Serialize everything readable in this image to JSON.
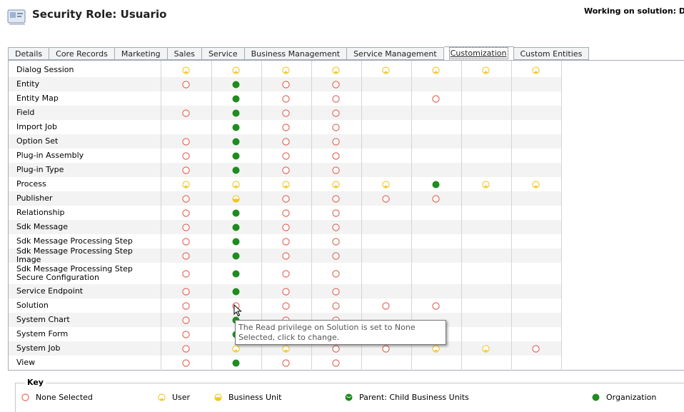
{
  "header": {
    "title": "Security Role: Usuario",
    "solution_text": "Working on solution: Defa"
  },
  "tabs": [
    {
      "label": "Details"
    },
    {
      "label": "Core Records"
    },
    {
      "label": "Marketing"
    },
    {
      "label": "Sales"
    },
    {
      "label": "Service"
    },
    {
      "label": "Business Management"
    },
    {
      "label": "Service Management"
    },
    {
      "label": "Customization",
      "active": true
    },
    {
      "label": "Custom Entities"
    }
  ],
  "privilege_levels": {
    "N": "None Selected",
    "U": "User",
    "B": "Business Unit",
    "P": "Parent: Child Business Units",
    "O": "Organization"
  },
  "colors": {
    "none": "#e25f4f",
    "user": "#f3c61f",
    "organization": "#1e8c1e",
    "tab_border": "#a5acb5"
  },
  "rows": [
    {
      "label": "Dialog Session",
      "cells": [
        "U",
        "U",
        "U",
        "U",
        "U",
        "U",
        "U",
        "U"
      ]
    },
    {
      "label": "Entity",
      "cells": [
        "N",
        "O",
        "N",
        "N",
        "",
        "",
        "",
        ""
      ]
    },
    {
      "label": "Entity Map",
      "cells": [
        "",
        "O",
        "N",
        "N",
        "",
        "N",
        "",
        ""
      ]
    },
    {
      "label": "Field",
      "cells": [
        "N",
        "O",
        "N",
        "N",
        "",
        "",
        "",
        ""
      ]
    },
    {
      "label": "Import Job",
      "cells": [
        "",
        "O",
        "N",
        "N",
        "",
        "",
        "",
        ""
      ]
    },
    {
      "label": "Option Set",
      "cells": [
        "N",
        "O",
        "N",
        "N",
        "",
        "",
        "",
        ""
      ]
    },
    {
      "label": "Plug-in Assembly",
      "cells": [
        "N",
        "O",
        "N",
        "N",
        "",
        "",
        "",
        ""
      ]
    },
    {
      "label": "Plug-in Type",
      "cells": [
        "N",
        "O",
        "N",
        "N",
        "",
        "",
        "",
        ""
      ]
    },
    {
      "label": "Process",
      "cells": [
        "U",
        "U",
        "U",
        "U",
        "U",
        "O",
        "U",
        "U"
      ]
    },
    {
      "label": "Publisher",
      "cells": [
        "N",
        "B",
        "N",
        "N",
        "N",
        "N",
        "",
        ""
      ]
    },
    {
      "label": "Relationship",
      "cells": [
        "N",
        "O",
        "N",
        "N",
        "",
        "",
        "",
        ""
      ]
    },
    {
      "label": "Sdk Message",
      "cells": [
        "N",
        "O",
        "N",
        "N",
        "",
        "",
        "",
        ""
      ]
    },
    {
      "label": "Sdk Message Processing Step",
      "cells": [
        "N",
        "O",
        "N",
        "N",
        "",
        "",
        "",
        ""
      ]
    },
    {
      "label": "Sdk Message Processing Step Image",
      "cells": [
        "N",
        "O",
        "N",
        "N",
        "",
        "",
        "",
        ""
      ]
    },
    {
      "label": "Sdk Message Processing Step Secure Configuration",
      "cells": [
        "N",
        "O",
        "N",
        "N",
        "",
        "",
        "",
        ""
      ]
    },
    {
      "label": "Service Endpoint",
      "cells": [
        "N",
        "O",
        "N",
        "N",
        "",
        "",
        "",
        ""
      ]
    },
    {
      "label": "Solution",
      "cells": [
        "N",
        "N",
        "N",
        "N",
        "N",
        "N",
        "",
        ""
      ]
    },
    {
      "label": "System Chart",
      "cells": [
        "N",
        "O",
        "N",
        "N",
        "",
        "",
        "",
        ""
      ]
    },
    {
      "label": "System Form",
      "cells": [
        "N",
        "O",
        "",
        "",
        "",
        "",
        "",
        ""
      ]
    },
    {
      "label": "System Job",
      "cells": [
        "N",
        "U",
        "U",
        "N",
        "N",
        "U",
        "U",
        "N"
      ]
    },
    {
      "label": "View",
      "cells": [
        "N",
        "O",
        "N",
        "N",
        "",
        "",
        "",
        ""
      ]
    }
  ],
  "tooltip": {
    "text": "The Read privilege on Solution is set to None Selected, click to change."
  },
  "key": {
    "title": "Key",
    "items": [
      {
        "level": "N",
        "label": "None Selected"
      },
      {
        "level": "U",
        "label": "User"
      },
      {
        "level": "B",
        "label": "Business Unit"
      },
      {
        "level": "P",
        "label": "Parent: Child Business Units"
      },
      {
        "level": "O",
        "label": "Organization"
      }
    ]
  }
}
